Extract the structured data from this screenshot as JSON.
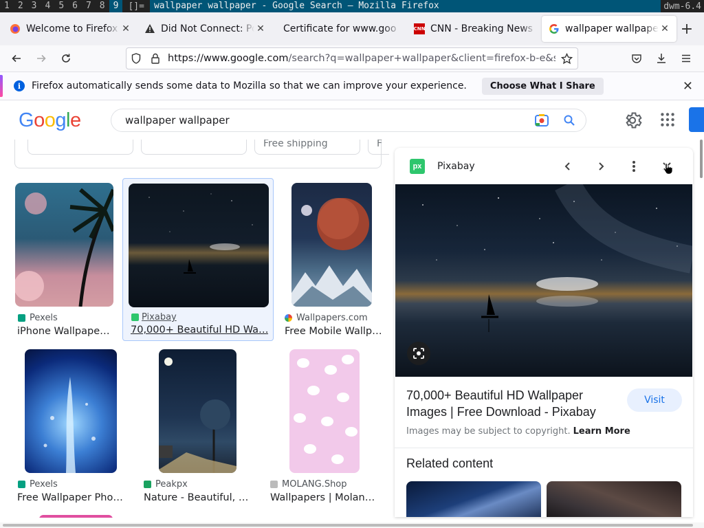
{
  "dwm": {
    "tags": [
      "1",
      "2",
      "3",
      "4",
      "5",
      "6",
      "7",
      "8",
      "9"
    ],
    "selected_tag": "9",
    "layout": "[]=",
    "window_title": "wallpaper wallpaper - Google Search — Mozilla Firefox",
    "status": "dwm-6.4"
  },
  "tabs": [
    {
      "label": "Welcome to Firefox",
      "icon": "firefox-icon"
    },
    {
      "label": "Did Not Connect: Pot",
      "icon": "warning-icon"
    },
    {
      "label": "Certificate for www.goo",
      "icon": "none"
    },
    {
      "label": "CNN - Breaking News",
      "icon": "cnn-icon"
    },
    {
      "label": "wallpaper wallpaper",
      "icon": "google-icon",
      "active": true
    }
  ],
  "nav": {
    "url_host": "https://www.google.com",
    "url_rest": "/search?q=wallpaper+wallpaper&client=firefox-b-e&so"
  },
  "notification": {
    "message": "Firefox automatically sends some data to Mozilla so that we can improve your experience.",
    "button": "Choose What I Share"
  },
  "google": {
    "logo": [
      "G",
      "o",
      "o",
      "g",
      "l",
      "e"
    ],
    "logo_colors": [
      "#4285f4",
      "#ea4335",
      "#fbbc05",
      "#4285f4",
      "#34a853",
      "#ea4335"
    ],
    "query": "wallpaper wallpaper"
  },
  "filters": {
    "chip_free_shipping": "Free shipping",
    "chip_partial": "F"
  },
  "results": [
    {
      "source": "Pexels",
      "title": "iPhone Wallpaper…",
      "fav_color": "#05a081"
    },
    {
      "source": "Pixabay",
      "title": "70,000+ Beautiful HD Wa…",
      "fav_color": "#2ec66d"
    },
    {
      "source": "Wallpapers.com",
      "title": "Free Mobile Wallp…",
      "fav_color": "#ea4335"
    },
    {
      "source": "Pexels",
      "title": "Free Wallpaper Phot…",
      "fav_color": "#05a081"
    },
    {
      "source": "Peakpx",
      "title": "Nature - Beautiful, H…",
      "fav_color": "#1aa260"
    },
    {
      "source": "MOLANG.Shop",
      "title": "Wallpapers | Molang…",
      "fav_color": "#999999"
    }
  ],
  "panel": {
    "site": "Pixabay",
    "logo_text": "px",
    "title": "70,000+ Beautiful HD Wallpaper Images | Free Download - Pixabay",
    "visit": "Visit",
    "copyright": "Images may be subject to copyright.",
    "learn_more": "Learn More",
    "related": "Related content"
  }
}
